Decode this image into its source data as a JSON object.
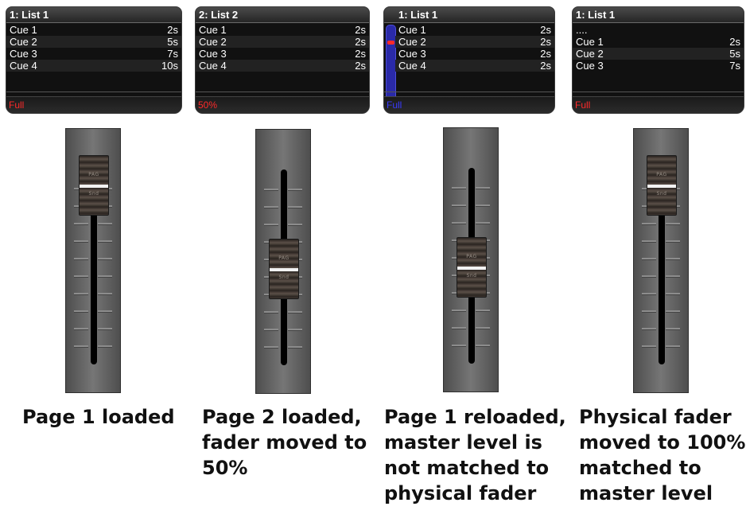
{
  "columns": [
    {
      "panel": {
        "title": "1: List 1",
        "rows": [
          {
            "cue": "Cue 1",
            "time": "2s"
          },
          {
            "cue": "Cue 2",
            "time": "5s"
          },
          {
            "cue": "Cue 3",
            "time": "7s"
          },
          {
            "cue": "Cue 4",
            "time": "10s"
          }
        ],
        "level_text": "Full",
        "level_color": "#ff2a2a"
      },
      "fader": {
        "cap_top_text": "PAG",
        "cap_bottom_text": "Snd"
      },
      "caption": [
        "Page 1 loaded"
      ]
    },
    {
      "panel": {
        "title": "2: List 2",
        "rows": [
          {
            "cue": "Cue 1",
            "time": "2s"
          },
          {
            "cue": "Cue 2",
            "time": "2s"
          },
          {
            "cue": "Cue 3",
            "time": "2s"
          },
          {
            "cue": "Cue 4",
            "time": "2s"
          }
        ],
        "level_text": "50%",
        "level_color": "#ff2a2a"
      },
      "fader": {
        "cap_top_text": "PAG",
        "cap_bottom_text": "Snd"
      },
      "caption": [
        "Page 2 loaded,",
        "fader moved to",
        "50%"
      ]
    },
    {
      "panel": {
        "title": "1: List 1",
        "rows": [
          {
            "cue": "Cue 1",
            "time": "2s"
          },
          {
            "cue": "Cue 2",
            "time": "2s"
          },
          {
            "cue": "Cue 3",
            "time": "2s"
          },
          {
            "cue": "Cue 4",
            "time": "2s"
          }
        ],
        "level_text": "Full",
        "level_color": "#3a3aff"
      },
      "fader": {
        "cap_top_text": "PAG",
        "cap_bottom_text": "Snd"
      },
      "caption": [
        "Page 1 reloaded,",
        "master level is",
        "not matched to",
        "physical fader"
      ]
    },
    {
      "panel": {
        "title": "1: List 1",
        "rows": [
          {
            "cue": "....",
            "time": ""
          },
          {
            "cue": "Cue 1",
            "time": "2s"
          },
          {
            "cue": "Cue 2",
            "time": "5s"
          },
          {
            "cue": "Cue 3",
            "time": "7s"
          }
        ],
        "level_text": "Full",
        "level_color": "#ff2a2a"
      },
      "fader": {
        "cap_top_text": "PAG",
        "cap_bottom_text": "Snd"
      },
      "caption": [
        "Physical fader",
        "moved to 100%",
        "matched to",
        "master level"
      ]
    }
  ]
}
